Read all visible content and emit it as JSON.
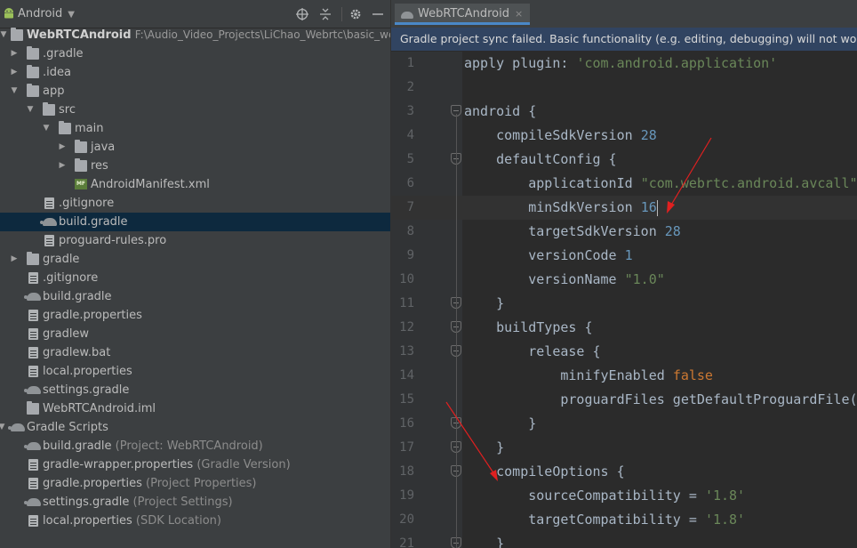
{
  "sidebar": {
    "view_mode": "Android",
    "root": {
      "name": "WebRTCAndroid",
      "path": "F:\\Audio_Video_Projects\\LiChao_Webrtc\\basic_webrt"
    },
    "items": [
      {
        "label": ".gradle"
      },
      {
        "label": ".idea"
      },
      {
        "label": "app"
      },
      {
        "label": "src"
      },
      {
        "label": "main"
      },
      {
        "label": "java"
      },
      {
        "label": "res"
      },
      {
        "label": "AndroidManifest.xml"
      },
      {
        "label": ".gitignore"
      },
      {
        "label": "build.gradle"
      },
      {
        "label": "proguard-rules.pro"
      },
      {
        "label": "gradle"
      },
      {
        "label": ".gitignore"
      },
      {
        "label": "build.gradle"
      },
      {
        "label": "gradle.properties"
      },
      {
        "label": "gradlew"
      },
      {
        "label": "gradlew.bat"
      },
      {
        "label": "local.properties"
      },
      {
        "label": "settings.gradle"
      },
      {
        "label": "WebRTCAndroid.iml"
      },
      {
        "label": "Gradle Scripts"
      },
      {
        "label": "build.gradle",
        "hint": "(Project: WebRTCAndroid)"
      },
      {
        "label": "gradle-wrapper.properties",
        "hint": "(Gradle Version)"
      },
      {
        "label": "gradle.properties",
        "hint": "(Project Properties)"
      },
      {
        "label": "settings.gradle",
        "hint": "(Project Settings)"
      },
      {
        "label": "local.properties",
        "hint": "(SDK Location)"
      }
    ]
  },
  "editor": {
    "tab": "WebRTCAndroid",
    "tab_close": "×",
    "banner": "Gradle project sync failed. Basic functionality (e.g. editing, debugging) will not work prop",
    "lines": [
      {
        "n": "1",
        "text": "apply plugin: 'com.android.application'"
      },
      {
        "n": "2",
        "text": ""
      },
      {
        "n": "3",
        "text": "android {"
      },
      {
        "n": "4",
        "text": "    compileSdkVersion 28"
      },
      {
        "n": "5",
        "text": "    defaultConfig {"
      },
      {
        "n": "6",
        "text": "        applicationId \"com.webrtc.android.avcall\""
      },
      {
        "n": "7",
        "text": "        minSdkVersion 16"
      },
      {
        "n": "8",
        "text": "        targetSdkVersion 28"
      },
      {
        "n": "9",
        "text": "        versionCode 1"
      },
      {
        "n": "10",
        "text": "        versionName \"1.0\""
      },
      {
        "n": "11",
        "text": "    }"
      },
      {
        "n": "12",
        "text": "    buildTypes {"
      },
      {
        "n": "13",
        "text": "        release {"
      },
      {
        "n": "14",
        "text": "            minifyEnabled false"
      },
      {
        "n": "15",
        "text": "            proguardFiles getDefaultProguardFile("
      },
      {
        "n": "16",
        "text": "        }"
      },
      {
        "n": "17",
        "text": "    }"
      },
      {
        "n": "18",
        "text": "    compileOptions {"
      },
      {
        "n": "19",
        "text": "        sourceCompatibility = '1.8'"
      },
      {
        "n": "20",
        "text": "        targetCompatibility = '1.8'"
      },
      {
        "n": "21",
        "text": "    }"
      }
    ]
  },
  "colors": {
    "keyword": "#cc7832",
    "string": "#6a8759",
    "number": "#6897bb",
    "text": "#a9b7c6",
    "annotation_arrow": "#e02020",
    "selection": "#0d293e",
    "banner": "#314461"
  }
}
